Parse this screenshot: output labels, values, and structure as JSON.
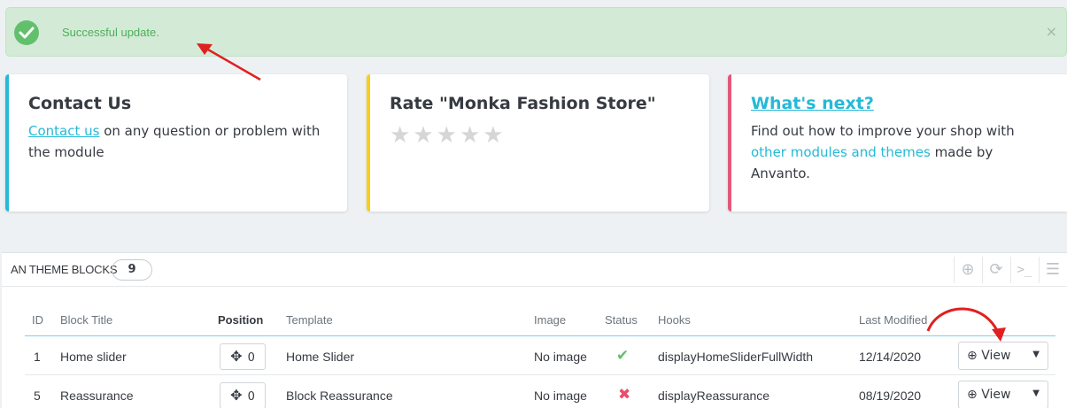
{
  "alert": {
    "message": "Successful update.",
    "close": "×"
  },
  "cards": {
    "contact": {
      "title": "Contact Us",
      "link": "Contact us",
      "text": " on any question or problem with the module"
    },
    "rate": {
      "title": "Rate \"Monka Fashion Store\"",
      "stars": 5
    },
    "next": {
      "title": "What's next?",
      "text_before": "Find out how to improve your shop with ",
      "link": "other modules and themes",
      "text_after": " made by Anvanto."
    }
  },
  "panel": {
    "title": "AN THEME BLOCKS",
    "count": "9",
    "columns": [
      "ID",
      "Block Title",
      "Position",
      "Template",
      "Image",
      "Status",
      "Hooks",
      "Last Modified"
    ],
    "rows": [
      {
        "id": "1",
        "title": "Home slider",
        "position": "0",
        "template": "Home Slider",
        "image": "No image",
        "status": "enabled",
        "hooks": "displayHomeSliderFullWidth",
        "modified": "12/14/2020",
        "action": "View"
      },
      {
        "id": "5",
        "title": "Reassurance",
        "position": "0",
        "template": "Block Reassurance",
        "image": "No image",
        "status": "disabled",
        "hooks": "displayReassurance",
        "modified": "08/19/2020",
        "action": "View"
      }
    ]
  },
  "colors": {
    "accent": "#25b9d7",
    "success": "#62c06c",
    "danger": "#e84f6a",
    "annotation": "#e02020"
  }
}
